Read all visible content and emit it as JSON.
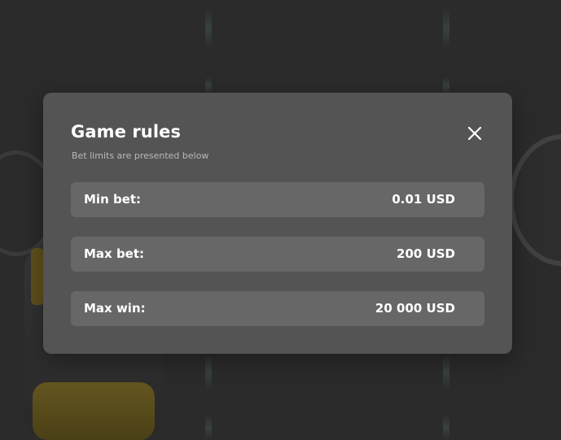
{
  "modal": {
    "title": "Game rules",
    "subtitle": "Bet limits are presented below",
    "close_icon": "close-icon",
    "rows": [
      {
        "label": "Min bet:",
        "value": "0.01 USD"
      },
      {
        "label": "Max bet:",
        "value": "200 USD"
      },
      {
        "label": "Max win:",
        "value": "20 000 USD"
      }
    ]
  },
  "colors": {
    "backdrop": "#2b2b2b",
    "modal_background": "#545454",
    "row_background": "#676767",
    "text_primary": "#ffffff",
    "text_secondary": "#b9b9b9"
  }
}
